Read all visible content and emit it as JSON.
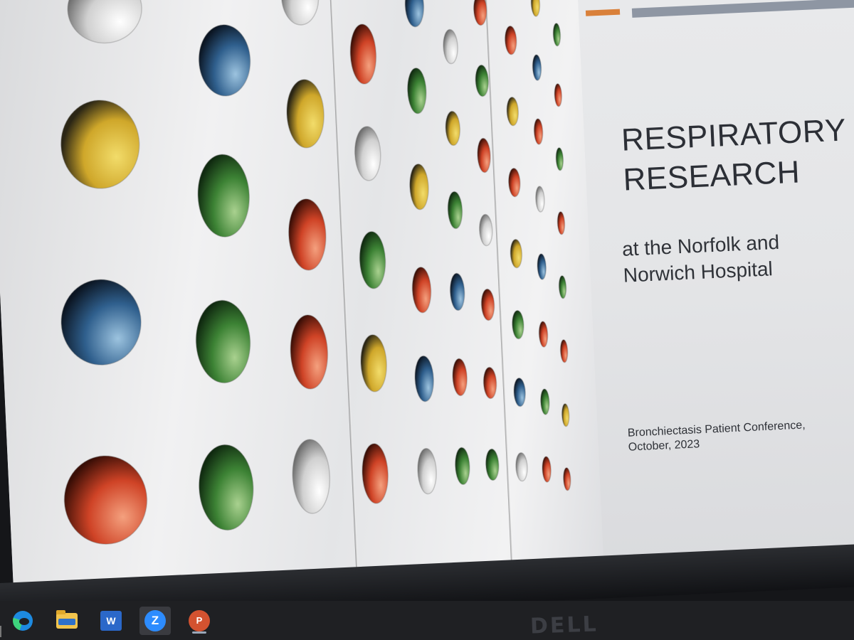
{
  "slide": {
    "title_line1": "RESPIRATORY",
    "title_line2": "RESEARCH",
    "subtitle_line1": "at the Norfolk and",
    "subtitle_line2": "Norwich Hospital",
    "footer_line1": "Bronchiectasis Patient Conference,",
    "footer_line2": "October, 2023"
  },
  "taskbar": {
    "items": [
      {
        "name": "edge",
        "icon": "edge-icon"
      },
      {
        "name": "file-explorer",
        "icon": "folder-icon"
      },
      {
        "name": "word",
        "icon": "word-icon",
        "label": "W"
      },
      {
        "name": "zoom",
        "icon": "zoom-icon",
        "label": "Z"
      },
      {
        "name": "powerpoint",
        "icon": "powerpoint-icon",
        "label": "P"
      }
    ]
  },
  "monitor": {
    "brand": "DELL"
  },
  "colors": {
    "accent_orange": "#d9803a",
    "accent_gray": "#8e96a3",
    "title_text": "#2c2f36",
    "dot_yellow": "#d9b52e",
    "dot_blue": "#2c5d8a",
    "dot_green": "#3f8a3a",
    "dot_red": "#d34a2a",
    "dot_white": "#d6d6d6"
  }
}
